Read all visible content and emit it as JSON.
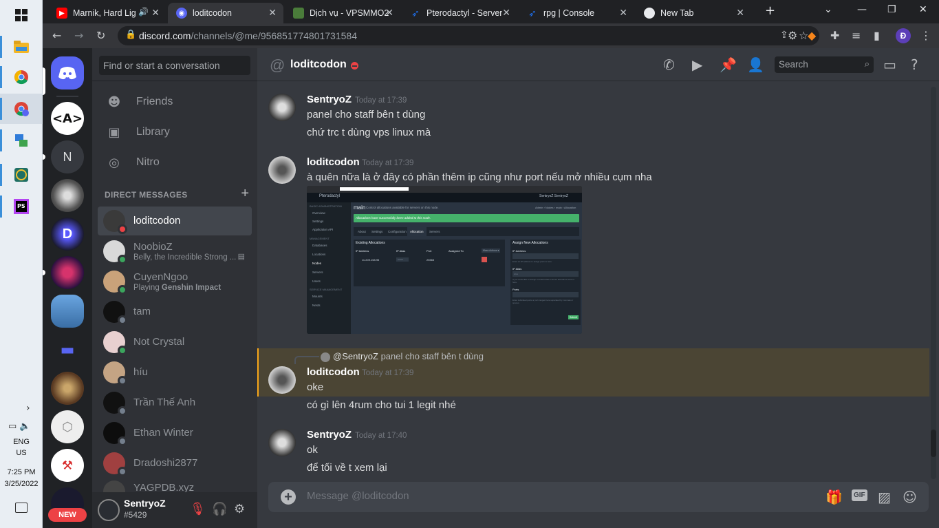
{
  "taskbar": {
    "lang": [
      "ENG",
      "US"
    ],
    "time": "7:25 PM",
    "date": "3/25/2022"
  },
  "browser": {
    "tabs": [
      {
        "title": "Marnik, Hard Lig",
        "favicon": "youtube-icon",
        "color": "#ff0000"
      },
      {
        "title": "loditcodon",
        "favicon": "discord-icon",
        "color": "#5865f2"
      },
      {
        "title": "Dịch vụ - VPSMMO2",
        "favicon": "minecraft-icon",
        "color": "#4a7c3a"
      },
      {
        "title": "Pterodactyl - Server",
        "favicon": "pterodactyl-icon",
        "color": "#1f6feb"
      },
      {
        "title": "rpg | Console",
        "favicon": "pterodactyl-icon",
        "color": "#1f6feb"
      },
      {
        "title": "New Tab",
        "favicon": "chrome-icon",
        "color": "#e8eaed"
      }
    ],
    "url_host": "discord.com",
    "url_path": "/channels/@me/956851774801731584",
    "profile_letter": "Đ"
  },
  "discord": {
    "guilds": [
      {
        "label": "discord-home",
        "color": "#5865f2"
      },
      {
        "label": "server-code",
        "color": "#ffffff"
      },
      {
        "label": "N",
        "color": "#36393f"
      },
      {
        "label": "server-compass",
        "color": "#444"
      },
      {
        "label": "server-d",
        "color": "#1a1a2e"
      },
      {
        "label": "server-cat",
        "color": "#2a1040"
      },
      {
        "label": "server-city",
        "color": "#3a6ea5"
      },
      {
        "label": "folder",
        "color": "#5865f2"
      },
      {
        "label": "server-wheel",
        "color": "#5a3a22"
      },
      {
        "label": "server-cube",
        "color": "#eeeeee"
      },
      {
        "label": "server-anvil",
        "color": "#ffffff"
      },
      {
        "label": "server-dragon",
        "color": "#1a1a2e"
      }
    ],
    "new_badge": "NEW",
    "dm_search_placeholder": "Find or start a conversation",
    "nav": [
      {
        "label": "Friends",
        "icon": "friends-icon"
      },
      {
        "label": "Library",
        "icon": "library-icon"
      },
      {
        "label": "Nitro",
        "icon": "nitro-icon"
      }
    ],
    "dm_header": "DIRECT MESSAGES",
    "dms": [
      {
        "name": "loditcodon",
        "sub": "",
        "status": "#ed4245",
        "avatar": "#3a3a3a"
      },
      {
        "name": "NoobioZ",
        "sub": "Belly, the Incredible Strong ...",
        "status": "#3ba55d",
        "avatar": "#d9d9d9"
      },
      {
        "name": "CuyenNgoo",
        "sub_prefix": "Playing ",
        "sub_bold": "Genshin Impact",
        "status": "#3ba55d",
        "avatar": "#c9a27a"
      },
      {
        "name": "tam",
        "sub": "",
        "status": "#747f8d",
        "avatar": "#111111"
      },
      {
        "name": "Not Crystal",
        "sub": "",
        "status": "#3ba55d",
        "avatar": "#e8d0d0"
      },
      {
        "name": "híu",
        "sub": "",
        "status": "#747f8d",
        "avatar": "#c4a484"
      },
      {
        "name": "Trần Thế Anh",
        "sub": "",
        "status": "#747f8d",
        "avatar": "#111111"
      },
      {
        "name": "Ethan Winter",
        "sub": "",
        "status": "#747f8d",
        "avatar": "#0d0d0d"
      },
      {
        "name": "Dradoshi2877",
        "sub": "",
        "status": "#747f8d",
        "avatar": "#a04040"
      },
      {
        "name": "YAGPDB.xyz",
        "sub": "",
        "status": "#3ba55d",
        "avatar": "#444444"
      }
    ],
    "user": {
      "name": "SentryoZ",
      "tag": "#5429"
    },
    "channel": {
      "name": "loditcodon",
      "search_placeholder": "Search"
    },
    "messages": [
      {
        "author": "SentryoZ",
        "time": "Today at 17:39",
        "lines": [
          "panel cho staff bên t dùng",
          "chứ trc t dùng vps linux mà"
        ]
      },
      {
        "author": "loditcodon",
        "time": "Today at 17:39",
        "lines": [
          "à quên nữa là ở đây có phần thêm ip cũng như port nếu mở nhiều cụm nha"
        ]
      },
      {
        "author": "loditcodon",
        "time": "Today at 17:39",
        "reply_to": "@SentryoZ",
        "reply_text": "panel cho staff bên t dùng",
        "lines": [
          "oke",
          "có gì lên 4rum cho tui 1 legit nhé"
        ]
      },
      {
        "author": "SentryoZ",
        "time": "Today at 17:40",
        "lines": [
          "ok",
          "để tối về t xem lại"
        ]
      }
    ],
    "attachment": {
      "brand": "Pterodactyl",
      "page_title": "main",
      "page_sub": "Control allocations available for servers on this node.",
      "crumbs": "Admin › Nodes › main › Allocation",
      "user_chip": "SentryoZ SentryoZ",
      "alert": "Allocations have successfully been added to this node.",
      "tabs": [
        "About",
        "Settings",
        "Configuration",
        "Allocation",
        "Servers"
      ],
      "side_admin_label": "BASIC ADMINISTRATION",
      "side_admin": [
        "Overview",
        "Settings",
        "Application API"
      ],
      "side_mgmt_label": "MANAGEMENT",
      "side_mgmt": [
        "Databases",
        "Locations",
        "Nodes",
        "Servers",
        "Users"
      ],
      "side_svc_label": "SERVICE MANAGEMENT",
      "side_svc": [
        "Mounts",
        "Nests"
      ],
      "existing_title": "Existing Allocations",
      "delete_btn": "Mass Actions ▾",
      "cols": [
        "IP Address",
        "IP Alias",
        "Port",
        "Assigned To"
      ],
      "row": {
        "ip": "11.209.158.95",
        "alias": "none",
        "port": "25565"
      },
      "assign_title": "Assign New Allocations",
      "fields": [
        {
          "label": "IP Address",
          "help": "Enter an IP address to assign ports to here."
        },
        {
          "label": "IP Alias",
          "placeholder": "alias",
          "help": "If you would like to assign a default alias to these allocations enter it here."
        },
        {
          "label": "Ports",
          "help": "Enter individual ports or port ranges here separated by commas or spaces."
        }
      ],
      "submit": "Submit"
    },
    "composer_placeholder": "Message @loditcodon",
    "composer_gif": "GIF"
  }
}
